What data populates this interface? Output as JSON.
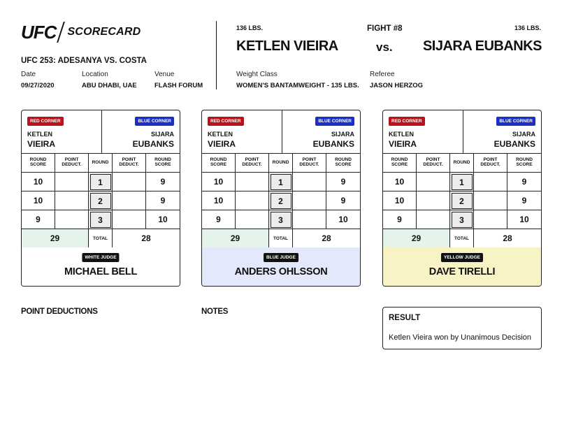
{
  "header": {
    "logo": "UFC",
    "scorecard": "SCORECARD",
    "event": "UFC 253: ADESANYA VS. COSTA",
    "date_label": "Date",
    "date": "09/27/2020",
    "location_label": "Location",
    "location": "ABU DHABI, UAE",
    "venue_label": "Venue",
    "venue": "FLASH FORUM",
    "weight_class_label": "Weight Class",
    "weight_class": "WOMEN'S BANTAMWEIGHT - 135 LBS.",
    "referee_label": "Referee",
    "referee": "JASON HERZOG",
    "fight_number": "FIGHT #8",
    "vs": "vs.",
    "red_fighter": "KETLEN VIEIRA",
    "red_weight": "136 LBS.",
    "blue_fighter": "SIJARA EUBANKS",
    "blue_weight": "136 LBS."
  },
  "card_labels": {
    "red_corner": "RED CORNER",
    "blue_corner": "BLUE CORNER",
    "red_first": "KETLEN",
    "red_last": "VIEIRA",
    "blue_first": "SIJARA",
    "blue_last": "EUBANKS",
    "round_score": "ROUND SCORE",
    "point_deduct": "POINT DEDUCT.",
    "round": "ROUND",
    "total": "TOTAL"
  },
  "cards": [
    {
      "judge_badge": "WHITE JUDGE",
      "judge_name": "MICHAEL BELL",
      "judge_color": "#ffffff",
      "rounds": [
        {
          "red_score": "10",
          "red_deduct": "",
          "round": "1",
          "blue_deduct": "",
          "blue_score": "9"
        },
        {
          "red_score": "10",
          "red_deduct": "",
          "round": "2",
          "blue_deduct": "",
          "blue_score": "9"
        },
        {
          "red_score": "9",
          "red_deduct": "",
          "round": "3",
          "blue_deduct": "",
          "blue_score": "10"
        }
      ],
      "red_total": "29",
      "blue_total": "28"
    },
    {
      "judge_badge": "BLUE JUDGE",
      "judge_name": "ANDERS OHLSSON",
      "judge_color": "#e3e8fb",
      "rounds": [
        {
          "red_score": "10",
          "red_deduct": "",
          "round": "1",
          "blue_deduct": "",
          "blue_score": "9"
        },
        {
          "red_score": "10",
          "red_deduct": "",
          "round": "2",
          "blue_deduct": "",
          "blue_score": "9"
        },
        {
          "red_score": "9",
          "red_deduct": "",
          "round": "3",
          "blue_deduct": "",
          "blue_score": "10"
        }
      ],
      "red_total": "29",
      "blue_total": "28"
    },
    {
      "judge_badge": "YELLOW JUDGE",
      "judge_name": "DAVE TIRELLI",
      "judge_color": "#f8f3c4",
      "rounds": [
        {
          "red_score": "10",
          "red_deduct": "",
          "round": "1",
          "blue_deduct": "",
          "blue_score": "9"
        },
        {
          "red_score": "10",
          "red_deduct": "",
          "round": "2",
          "blue_deduct": "",
          "blue_score": "9"
        },
        {
          "red_score": "9",
          "red_deduct": "",
          "round": "3",
          "blue_deduct": "",
          "blue_score": "10"
        }
      ],
      "red_total": "29",
      "blue_total": "28"
    }
  ],
  "footer": {
    "point_deductions": "POINT DEDUCTIONS",
    "notes": "NOTES",
    "result_heading": "RESULT",
    "result_text": "Ketlen Vieira won by Unanimous Decision"
  },
  "colors": {
    "red_corner": "#b8121b",
    "blue_corner": "#1b2fc6",
    "total_highlight": "#e4f4ea"
  }
}
